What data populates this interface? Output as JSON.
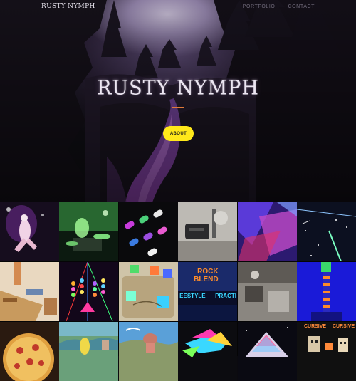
{
  "site": {
    "brand": "RUSTY NYMPH",
    "nav": [
      "PORTFOLIO",
      "CONTACT"
    ]
  },
  "hero": {
    "title": "RUSTY NYMPH",
    "button_label": "ABOUT",
    "accent_color": "#e07a3a",
    "button_color": "#ffe81a"
  },
  "portfolio": {
    "tiles": [
      {
        "name": "dancer-purple-lights"
      },
      {
        "name": "green-night-drummer"
      },
      {
        "name": "colored-pills-on-black"
      },
      {
        "name": "gray-desk-machine"
      },
      {
        "name": "purple-refraction"
      },
      {
        "name": "starry-night-streak"
      },
      {
        "name": "wooden-cardboard-controller"
      },
      {
        "name": "colored-ball-chains"
      },
      {
        "name": "glowing-cubes-board"
      },
      {
        "name": "rock-blend-game-menu",
        "texts": [
          "ROCK",
          "BLEND",
          "EESTYLE",
          "PRACTI"
        ]
      },
      {
        "name": "gray-video-still"
      },
      {
        "name": "blue-totem-figure"
      },
      {
        "name": "pizza"
      },
      {
        "name": "painted-landscape-figure"
      },
      {
        "name": "painted-sky-figure"
      },
      {
        "name": "colorful-splash"
      },
      {
        "name": "rainbow-mountain-night"
      },
      {
        "name": "pixel-character-pair",
        "texts": [
          "CURSIVE",
          "CURSIVE"
        ]
      }
    ]
  }
}
